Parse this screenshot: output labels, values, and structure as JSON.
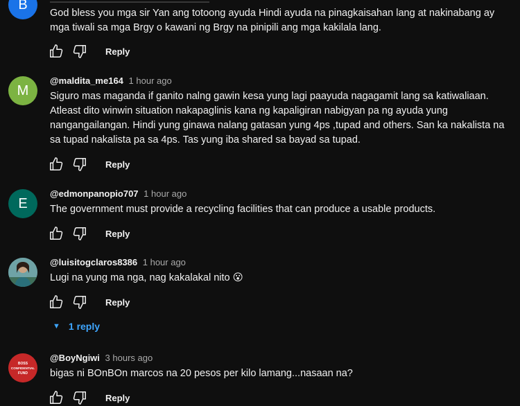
{
  "comments": [
    {
      "avatar_letter": "B",
      "avatar_color": "#1a73e8",
      "handle": "",
      "time": "",
      "text": "God bless you mga sir Yan ang totoong ayuda Hindi ayuda na pinagkaisahan lang at nakinabang ay mga tiwali sa mga Brgy o kawani ng Brgy na pinipili ang mga kakilala lang.",
      "reply_label": "Reply"
    },
    {
      "avatar_letter": "M",
      "avatar_color": "#7cb342",
      "handle": "@maldita_me164",
      "time": "1 hour ago",
      "text": "Siguro mas maganda if ganito nalng gawin kesa yung lagi paayuda nagagamit lang sa katiwaliaan. Atleast dito winwin situation nakapaglinis kana ng kapaligiran nabigyan pa ng ayuda yung nangangailangan. Hindi yung ginawa nalang gatasan yung 4ps ,tupad and others. San ka nakalista na sa tupad nakalista pa sa 4ps. Tas yung iba shared sa bayad sa tupad.",
      "reply_label": "Reply"
    },
    {
      "avatar_letter": "E",
      "avatar_color": "#00695c",
      "handle": "@edmonpanopio707",
      "time": "1 hour ago",
      "text": "The government must provide a recycling facilities that can produce a usable products.",
      "reply_label": "Reply"
    },
    {
      "avatar_letter": "",
      "avatar_color": "#4e7f86",
      "handle": "@luisitogclaros8386",
      "time": "1 hour ago",
      "text": "Lugi na yung ma nga, nag kakalakal nito 😮",
      "reply_label": "Reply",
      "replies_label": "1 reply"
    },
    {
      "avatar_letter": "",
      "avatar_logo_text": "BOSS CONFIDENTIAL FUND",
      "avatar_color": "#c62828",
      "handle": "@BoyNgiwi",
      "time": "3 hours ago",
      "text": "bigas ni BOnBOn marcos na 20 pesos per kilo lamang...nasaan na?",
      "reply_label": "Reply"
    }
  ],
  "icons": {
    "like": "thumbs-up-icon",
    "dislike": "thumbs-down-icon",
    "replies": "chevron-down-icon"
  },
  "colors": {
    "background": "#0f0f0f",
    "text": "#f1f1f1",
    "meta": "#aaaaaa",
    "link": "#3ea6ff"
  }
}
